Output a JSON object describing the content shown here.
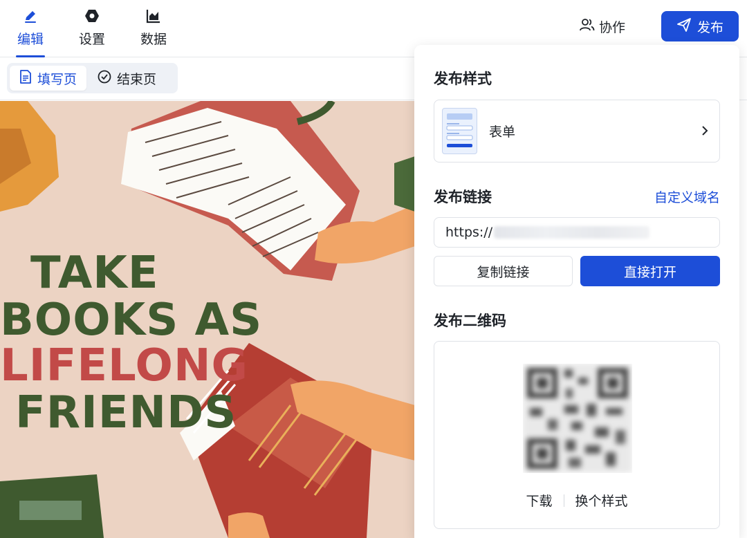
{
  "header": {
    "tabs": [
      {
        "label": "编辑",
        "icon": "pencil-icon",
        "active": true
      },
      {
        "label": "设置",
        "icon": "hexagon-gear-icon",
        "active": false
      },
      {
        "label": "数据",
        "icon": "chart-icon",
        "active": false
      }
    ],
    "collab_label": "协作",
    "publish_label": "发布",
    "accent": "#1d4ed8"
  },
  "subbar": {
    "fill_page_label": "填写页",
    "end_page_label": "结束页"
  },
  "poster": {
    "lines": [
      "TAKE",
      "BOOKS AS",
      "LIFELONG",
      "FRIENDS"
    ],
    "background": "#ecd3c3",
    "green": "#3f5a2f",
    "red": "#c24a48"
  },
  "publish_panel": {
    "style_title": "发布样式",
    "style_name": "表单",
    "link_title": "发布链接",
    "custom_domain_label": "自定义域名",
    "url_prefix": "https://",
    "copy_label": "复制链接",
    "open_label": "直接打开",
    "qr_title": "发布二维码",
    "download_label": "下载",
    "change_style_label": "换个样式"
  }
}
